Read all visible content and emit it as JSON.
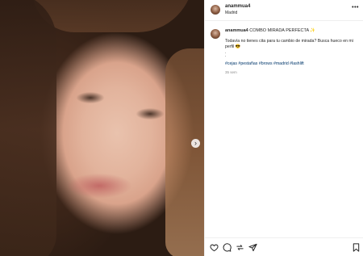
{
  "post": {
    "username": "anammua4",
    "location": "Madrid",
    "more_label": "•••"
  },
  "caption": {
    "username": "anammua4",
    "title": "COMBO MIRADA PERFECTA ✨",
    "body": "Todavía no tienes cita para tu cambio de mirada? Busca hueco en mi perfil 😎",
    "dots": ".\n.",
    "hashtags": "#cejas #pestañas #brows #madrid #lashlift",
    "time": "35 sem"
  },
  "carousel": {
    "next_label": "›"
  },
  "icons": [
    "heart-icon",
    "comment-icon",
    "share-icon",
    "send-icon",
    "bookmark-icon"
  ]
}
